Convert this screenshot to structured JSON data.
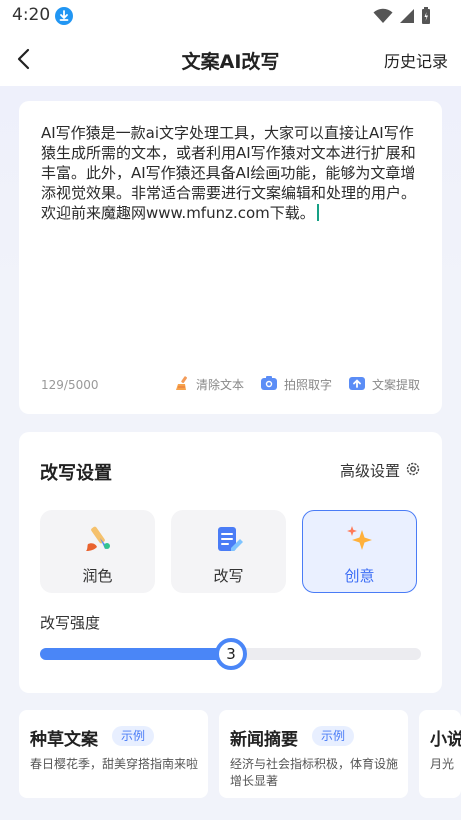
{
  "status_bar": {
    "time": "4:20"
  },
  "header": {
    "title": "文案AI改写",
    "history_label": "历史记录"
  },
  "editor": {
    "text": "AI写作猿是一款ai文字处理工具，大家可以直接让AI写作猿生成所需的文本，或者利用AI写作猿对文本进行扩展和丰富。此外，AI写作猿还具备AI绘画功能，能够为文章增添视觉效果。非常适合需要进行文案编辑和处理的用户。欢迎前来魔趣网www.mfunz.com下载。",
    "counter": "129/5000",
    "actions": [
      {
        "label": "清除文本",
        "icon": "broom-icon"
      },
      {
        "label": "拍照取字",
        "icon": "camera-icon"
      },
      {
        "label": "文案提取",
        "icon": "upload-icon"
      }
    ]
  },
  "settings": {
    "title": "改写设置",
    "advanced_label": "高级设置",
    "modes": [
      {
        "label": "润色",
        "icon": "brush-icon",
        "active": false
      },
      {
        "label": "改写",
        "icon": "document-edit-icon",
        "active": false
      },
      {
        "label": "创意",
        "icon": "sparkle-icon",
        "active": true
      }
    ],
    "strength_label": "改写强度",
    "strength_value": "3",
    "strength_fraction": 0.5
  },
  "examples": [
    {
      "title": "种草文案",
      "tag": "示例",
      "desc": "春日樱花季，甜美穿搭指南来啦"
    },
    {
      "title": "新闻摘要",
      "tag": "示例",
      "desc": "经济与社会指标积极，体育设施增长显著"
    },
    {
      "title": "小说",
      "tag": "",
      "desc": "月光"
    }
  ],
  "colors": {
    "accent": "#4a86f7",
    "active_mode_bg": "#eaf0ff",
    "caret": "#16a085"
  }
}
